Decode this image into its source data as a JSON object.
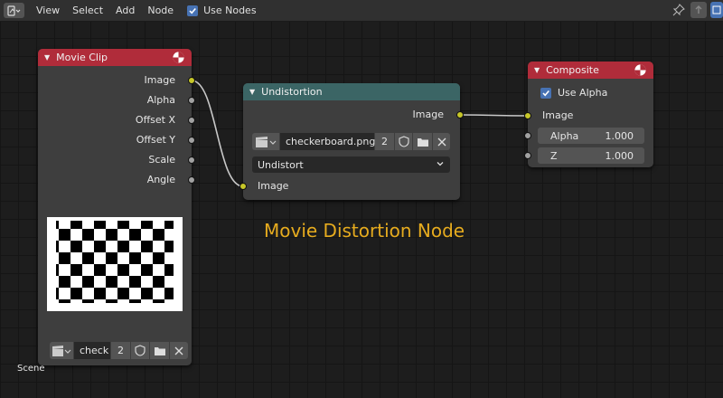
{
  "menubar": {
    "items": [
      "View",
      "Select",
      "Add",
      "Node"
    ],
    "use_nodes_label": "Use Nodes",
    "use_nodes_checked": true
  },
  "nodes": {
    "movie_clip": {
      "title": "Movie Clip",
      "header_color": "#b02c3a",
      "outputs": [
        "Image",
        "Alpha",
        "Offset X",
        "Offset Y",
        "Scale",
        "Angle"
      ],
      "clip_name": "check",
      "users": "2"
    },
    "undistortion": {
      "title": "Undistortion",
      "header_color": "#3b6565",
      "output": "Image",
      "clip_name": "checkerboard.png",
      "users": "2",
      "mode": "Undistort",
      "input": "Image"
    },
    "composite": {
      "title": "Composite",
      "header_color": "#b02c3a",
      "use_alpha_label": "Use Alpha",
      "use_alpha_checked": true,
      "input": "Image",
      "alpha_label": "Alpha",
      "alpha_value": "1.000",
      "z_label": "Z",
      "z_value": "1.000"
    }
  },
  "annotation": "Movie Distortion Node",
  "scene_label": "Scene",
  "colors": {
    "image_socket": "#c7c729",
    "value_socket": "#a1a1a1",
    "link": "#c8c8c8",
    "annotation": "#e6ab1e",
    "checkbox": "#4772b3"
  }
}
